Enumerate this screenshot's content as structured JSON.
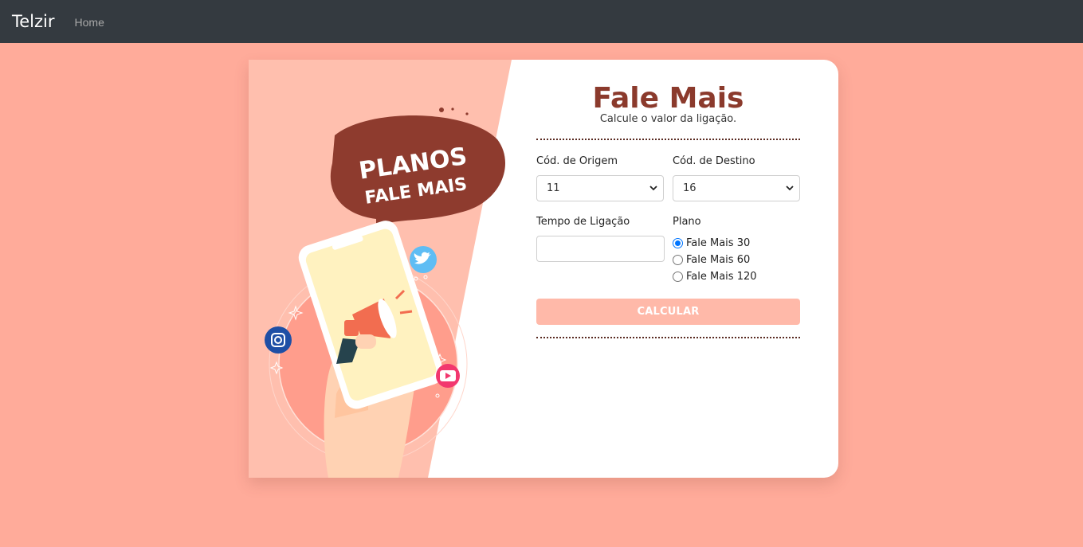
{
  "navbar": {
    "brand": "Telzir",
    "home": "Home"
  },
  "illustration": {
    "bubble_line1": "PLANOS",
    "bubble_line2": "FALE MAIS"
  },
  "form": {
    "title": "Fale Mais",
    "subtitle": "Calcule o valor da ligação.",
    "origin_label": "Cód. de Origem",
    "origin_value": "11",
    "destination_label": "Cód. de Destino",
    "destination_value": "16",
    "time_label": "Tempo de Ligação",
    "time_value": "",
    "plan_label": "Plano",
    "plans": [
      {
        "label": "Fale Mais 30",
        "selected": true
      },
      {
        "label": "Fale Mais 60",
        "selected": false
      },
      {
        "label": "Fale Mais 120",
        "selected": false
      }
    ],
    "submit_label": "CALCULAR"
  },
  "colors": {
    "page_background": "#ffab9a",
    "navbar": "#343a40",
    "accent": "#8b3a2c",
    "button": "#ffb9a9",
    "radio_selected": "#0075ff"
  },
  "icons": [
    "chevron-down-icon",
    "twitter-icon",
    "instagram-icon",
    "youtube-icon",
    "megaphone-icon"
  ]
}
